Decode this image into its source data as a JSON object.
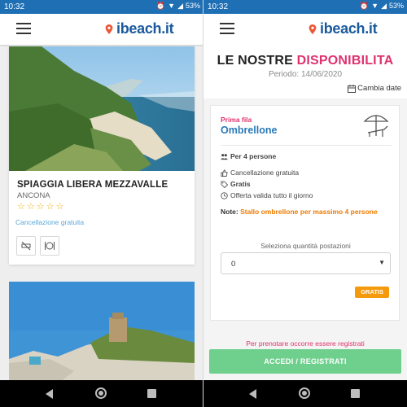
{
  "left": {
    "status": {
      "time": "10:32",
      "battery": "53%"
    },
    "logo": "ibeach.it",
    "beach": {
      "name": "SPIAGGIA LIBERA MEZZAVALLE",
      "city": "ANCONA",
      "rating_stars": "☆☆☆☆☆",
      "cancellation": "Cancellazione gratuita",
      "services": [
        "no-smoking-icon",
        "restaurant-icon"
      ]
    }
  },
  "right": {
    "status": {
      "time": "10:32",
      "battery": "53%"
    },
    "logo": "ibeach.it",
    "title_part1": "LE NOSTRE ",
    "title_part2": "DISPONIBILITA",
    "period": "Periodo: 14/06/2020",
    "change_date": "Cambia date",
    "offer": {
      "row": "Prima fila",
      "product": "Ombrellone",
      "features": [
        "Per 4 persone",
        "Cancellazione gratuita",
        "Gratis",
        "Offerta valida tutto il giorno"
      ],
      "note_label": "Note: ",
      "note_text": "Stallo ombrellone per massimo 4 persone",
      "select_label": "Seleziona quantità postazioni",
      "select_value": "0",
      "price_badge": "GRATIS"
    },
    "register_notice": "Per prenotare occorre essere registrati",
    "cta": "ACCEDI / REGISTRATI"
  },
  "colors": {
    "statusbar": "#1f6fb5",
    "brand": "#1a5a9c",
    "accent_pink": "#e0316e",
    "accent_blue": "#2a7ab8",
    "cta_green": "#6fcf8c",
    "badge_orange": "#f59a0c"
  }
}
